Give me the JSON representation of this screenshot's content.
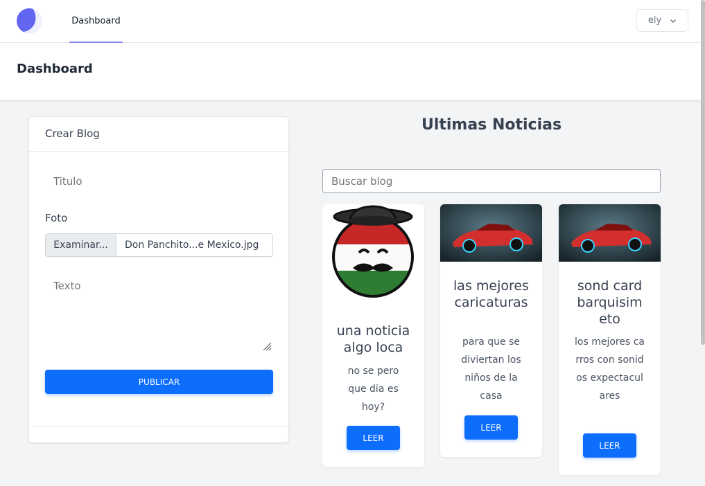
{
  "nav": {
    "dashboard_link": "Dashboard",
    "user_name": "ely"
  },
  "header": {
    "title": "Dashboard"
  },
  "create_blog": {
    "title": "Crear Blog",
    "titulo_placeholder": "Titulo",
    "foto_label": "Foto",
    "file_button": "Examinar...",
    "file_name": "Don Panchito...e Mexico.jpg",
    "texto_placeholder": "Texto",
    "publish_button": "PUBLICAR"
  },
  "news": {
    "title": "Ultimas Noticias",
    "search_placeholder": "Buscar blog",
    "cards": [
      {
        "title": "una noticia algo loca",
        "text": "no se pero que dia es hoy?",
        "button": "LEER",
        "image": "mexicoball-image"
      },
      {
        "title": "las mejores caricaturas",
        "text": "para que se diviertan los niños de la casa",
        "button": "LEER",
        "image": "red-car-image"
      },
      {
        "title": "sond card barquisimeto",
        "text": "los mejores carros con sonidos expectaculares",
        "button": "LEER",
        "image": "red-car-image"
      }
    ]
  },
  "colors": {
    "primary": "#0d6efd",
    "accent": "#818cf8",
    "logo": "#6366f1"
  }
}
